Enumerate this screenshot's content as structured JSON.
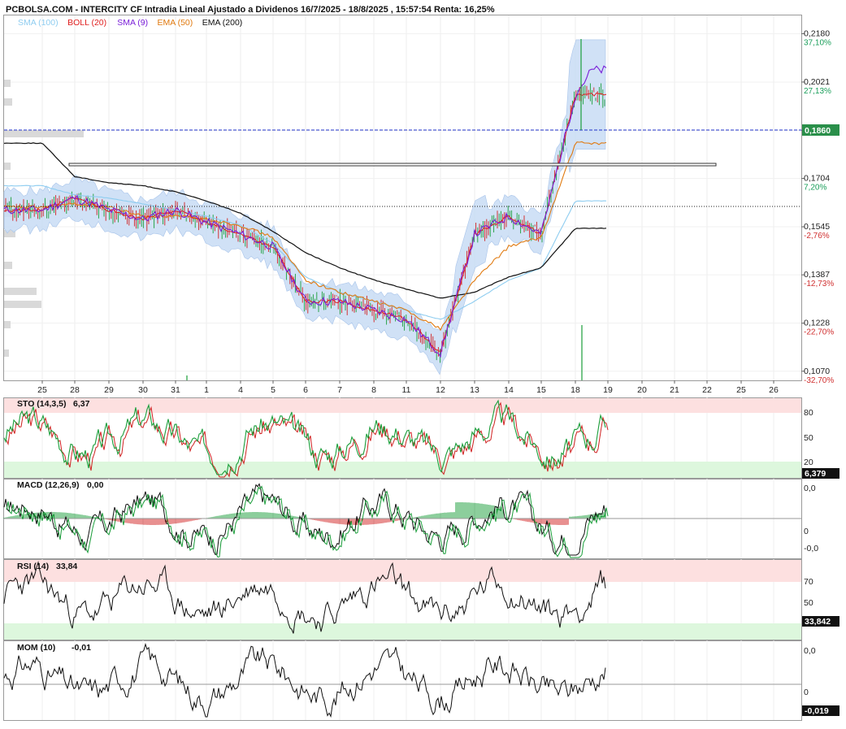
{
  "header": {
    "title": "PCBOLSA.COM - INTERCITY CF Intradia Lineal Ajustado a Dividenos 16/7/2025 - 18/8/2025 , 15:57:54 Renta: 16,25%"
  },
  "legend": [
    {
      "label": "SMA (100)",
      "color": "#8fcdf0"
    },
    {
      "label": "BOLL (20)",
      "color": "#e02020"
    },
    {
      "label": "SMA (9)",
      "color": "#7a1fd8"
    },
    {
      "label": "EMA (50)",
      "color": "#e07a10"
    },
    {
      "label": "EMA (200)",
      "color": "#111111"
    }
  ],
  "price_axis": [
    {
      "price": "0,2180",
      "pct": "37,10%",
      "sign": "pos"
    },
    {
      "price": "0,2021",
      "pct": "27,13%",
      "sign": "pos"
    },
    {
      "price": "0,1862",
      "pct": "",
      "sign": "pos"
    },
    {
      "price": "0,1704",
      "pct": "7,20%",
      "sign": "pos"
    },
    {
      "price": "0,1545",
      "pct": "-2,76%",
      "sign": "neg"
    },
    {
      "price": "0,1387",
      "pct": "-12,73%",
      "sign": "neg"
    },
    {
      "price": "0,1228",
      "pct": "-22,70%",
      "sign": "neg"
    },
    {
      "price": "0,1070",
      "pct": "-32,70%",
      "sign": "neg"
    }
  ],
  "current_price_tag": "0,1860",
  "date_axis": [
    "25",
    "28",
    "29",
    "30",
    "31",
    "1",
    "4",
    "5",
    "6",
    "7",
    "8",
    "11",
    "12",
    "13",
    "14",
    "15",
    "18",
    "19",
    "20",
    "21",
    "22",
    "25",
    "26"
  ],
  "colors": {
    "up": "#1a9e3a",
    "down": "#d02020",
    "pos": "#1a9e5a",
    "neg": "#d03030",
    "tag": "#2a8f4a",
    "ref": "#2233cc"
  },
  "indicators": {
    "sto": {
      "label": "STO (14,3,5)",
      "value": "6,37",
      "levels": [
        "80",
        "50",
        "20"
      ],
      "tag": "6,379"
    },
    "macd": {
      "label": "MACD (12,26,9)",
      "value": "0,00",
      "levels": [
        "0,0",
        "0",
        "-0,0"
      ]
    },
    "rsi": {
      "label": "RSI (14)",
      "value": "33,84",
      "levels": [
        "70",
        "50"
      ],
      "tag": "33,842"
    },
    "mom": {
      "label": "MOM (10)",
      "value": "-0,01",
      "levels": [
        "0,0",
        "0"
      ],
      "tag": "-0,019"
    }
  },
  "chart_data": {
    "type": "line",
    "title": "PCBOLSA.COM - INTERCITY CF Intradia Lineal Ajustado a Dividenos 16/7/2025 - 18/8/2025 , 15:57:54 Renta: 16,25%",
    "xlabel": "",
    "ylabel": "",
    "ylim": [
      0.104,
      0.224
    ],
    "categories": [
      "25",
      "28",
      "29",
      "30",
      "31",
      "1",
      "4",
      "5",
      "6",
      "7",
      "8",
      "11",
      "12",
      "13",
      "14",
      "15",
      "18"
    ],
    "series": [
      {
        "name": "SMA (9)",
        "values": [
          0.16,
          0.164,
          0.16,
          0.157,
          0.16,
          0.156,
          0.152,
          0.148,
          0.13,
          0.13,
          0.127,
          0.124,
          0.113,
          0.152,
          0.158,
          0.152,
          0.198
        ]
      },
      {
        "name": "EMA (50)",
        "values": [
          0.161,
          0.162,
          0.161,
          0.158,
          0.158,
          0.157,
          0.155,
          0.151,
          0.137,
          0.133,
          0.13,
          0.127,
          0.121,
          0.137,
          0.148,
          0.151,
          0.182
        ]
      },
      {
        "name": "EMA (200)",
        "values": [
          0.182,
          0.171,
          0.169,
          0.168,
          0.166,
          0.163,
          0.159,
          0.153,
          0.146,
          0.141,
          0.137,
          0.134,
          0.131,
          0.133,
          0.138,
          0.141,
          0.154
        ]
      },
      {
        "name": "SMA (100)",
        "values": [
          0.168,
          0.165,
          0.164,
          0.162,
          0.16,
          0.158,
          0.155,
          0.149,
          0.138,
          0.133,
          0.13,
          0.127,
          0.124,
          0.13,
          0.137,
          0.141,
          0.163
        ]
      }
    ],
    "current_price": 0.186,
    "sto": {
      "value": 6.37,
      "levels": [
        80,
        50,
        20
      ]
    },
    "macd": {
      "value": 0.0
    },
    "rsi": {
      "value": 33.84,
      "levels": [
        70,
        50
      ]
    },
    "mom": {
      "value": -0.01
    }
  }
}
